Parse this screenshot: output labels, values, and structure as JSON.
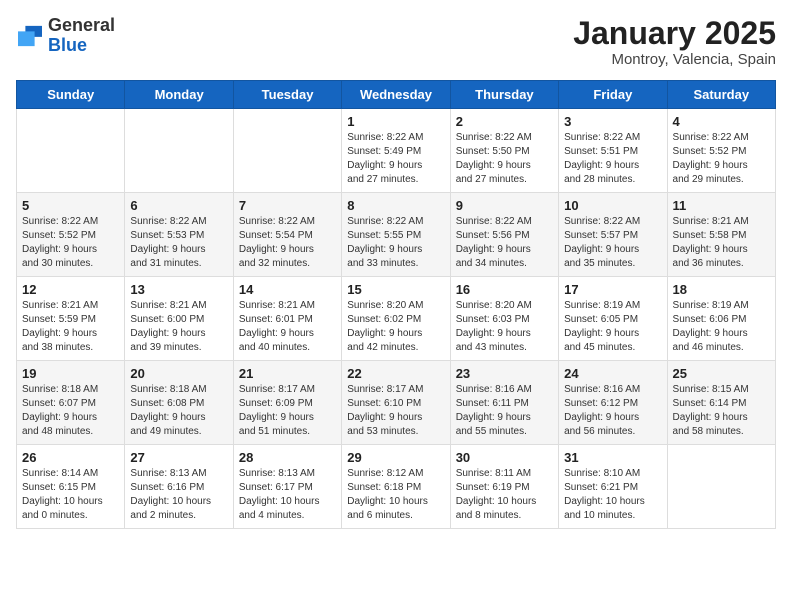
{
  "logo": {
    "general": "General",
    "blue": "Blue"
  },
  "title": {
    "month": "January 2025",
    "location": "Montroy, Valencia, Spain"
  },
  "weekdays": [
    "Sunday",
    "Monday",
    "Tuesday",
    "Wednesday",
    "Thursday",
    "Friday",
    "Saturday"
  ],
  "weeks": [
    [
      {
        "day": "",
        "info": ""
      },
      {
        "day": "",
        "info": ""
      },
      {
        "day": "",
        "info": ""
      },
      {
        "day": "1",
        "info": "Sunrise: 8:22 AM\nSunset: 5:49 PM\nDaylight: 9 hours\nand 27 minutes."
      },
      {
        "day": "2",
        "info": "Sunrise: 8:22 AM\nSunset: 5:50 PM\nDaylight: 9 hours\nand 27 minutes."
      },
      {
        "day": "3",
        "info": "Sunrise: 8:22 AM\nSunset: 5:51 PM\nDaylight: 9 hours\nand 28 minutes."
      },
      {
        "day": "4",
        "info": "Sunrise: 8:22 AM\nSunset: 5:52 PM\nDaylight: 9 hours\nand 29 minutes."
      }
    ],
    [
      {
        "day": "5",
        "info": "Sunrise: 8:22 AM\nSunset: 5:52 PM\nDaylight: 9 hours\nand 30 minutes."
      },
      {
        "day": "6",
        "info": "Sunrise: 8:22 AM\nSunset: 5:53 PM\nDaylight: 9 hours\nand 31 minutes."
      },
      {
        "day": "7",
        "info": "Sunrise: 8:22 AM\nSunset: 5:54 PM\nDaylight: 9 hours\nand 32 minutes."
      },
      {
        "day": "8",
        "info": "Sunrise: 8:22 AM\nSunset: 5:55 PM\nDaylight: 9 hours\nand 33 minutes."
      },
      {
        "day": "9",
        "info": "Sunrise: 8:22 AM\nSunset: 5:56 PM\nDaylight: 9 hours\nand 34 minutes."
      },
      {
        "day": "10",
        "info": "Sunrise: 8:22 AM\nSunset: 5:57 PM\nDaylight: 9 hours\nand 35 minutes."
      },
      {
        "day": "11",
        "info": "Sunrise: 8:21 AM\nSunset: 5:58 PM\nDaylight: 9 hours\nand 36 minutes."
      }
    ],
    [
      {
        "day": "12",
        "info": "Sunrise: 8:21 AM\nSunset: 5:59 PM\nDaylight: 9 hours\nand 38 minutes."
      },
      {
        "day": "13",
        "info": "Sunrise: 8:21 AM\nSunset: 6:00 PM\nDaylight: 9 hours\nand 39 minutes."
      },
      {
        "day": "14",
        "info": "Sunrise: 8:21 AM\nSunset: 6:01 PM\nDaylight: 9 hours\nand 40 minutes."
      },
      {
        "day": "15",
        "info": "Sunrise: 8:20 AM\nSunset: 6:02 PM\nDaylight: 9 hours\nand 42 minutes."
      },
      {
        "day": "16",
        "info": "Sunrise: 8:20 AM\nSunset: 6:03 PM\nDaylight: 9 hours\nand 43 minutes."
      },
      {
        "day": "17",
        "info": "Sunrise: 8:19 AM\nSunset: 6:05 PM\nDaylight: 9 hours\nand 45 minutes."
      },
      {
        "day": "18",
        "info": "Sunrise: 8:19 AM\nSunset: 6:06 PM\nDaylight: 9 hours\nand 46 minutes."
      }
    ],
    [
      {
        "day": "19",
        "info": "Sunrise: 8:18 AM\nSunset: 6:07 PM\nDaylight: 9 hours\nand 48 minutes."
      },
      {
        "day": "20",
        "info": "Sunrise: 8:18 AM\nSunset: 6:08 PM\nDaylight: 9 hours\nand 49 minutes."
      },
      {
        "day": "21",
        "info": "Sunrise: 8:17 AM\nSunset: 6:09 PM\nDaylight: 9 hours\nand 51 minutes."
      },
      {
        "day": "22",
        "info": "Sunrise: 8:17 AM\nSunset: 6:10 PM\nDaylight: 9 hours\nand 53 minutes."
      },
      {
        "day": "23",
        "info": "Sunrise: 8:16 AM\nSunset: 6:11 PM\nDaylight: 9 hours\nand 55 minutes."
      },
      {
        "day": "24",
        "info": "Sunrise: 8:16 AM\nSunset: 6:12 PM\nDaylight: 9 hours\nand 56 minutes."
      },
      {
        "day": "25",
        "info": "Sunrise: 8:15 AM\nSunset: 6:14 PM\nDaylight: 9 hours\nand 58 minutes."
      }
    ],
    [
      {
        "day": "26",
        "info": "Sunrise: 8:14 AM\nSunset: 6:15 PM\nDaylight: 10 hours\nand 0 minutes."
      },
      {
        "day": "27",
        "info": "Sunrise: 8:13 AM\nSunset: 6:16 PM\nDaylight: 10 hours\nand 2 minutes."
      },
      {
        "day": "28",
        "info": "Sunrise: 8:13 AM\nSunset: 6:17 PM\nDaylight: 10 hours\nand 4 minutes."
      },
      {
        "day": "29",
        "info": "Sunrise: 8:12 AM\nSunset: 6:18 PM\nDaylight: 10 hours\nand 6 minutes."
      },
      {
        "day": "30",
        "info": "Sunrise: 8:11 AM\nSunset: 6:19 PM\nDaylight: 10 hours\nand 8 minutes."
      },
      {
        "day": "31",
        "info": "Sunrise: 8:10 AM\nSunset: 6:21 PM\nDaylight: 10 hours\nand 10 minutes."
      },
      {
        "day": "",
        "info": ""
      }
    ]
  ]
}
